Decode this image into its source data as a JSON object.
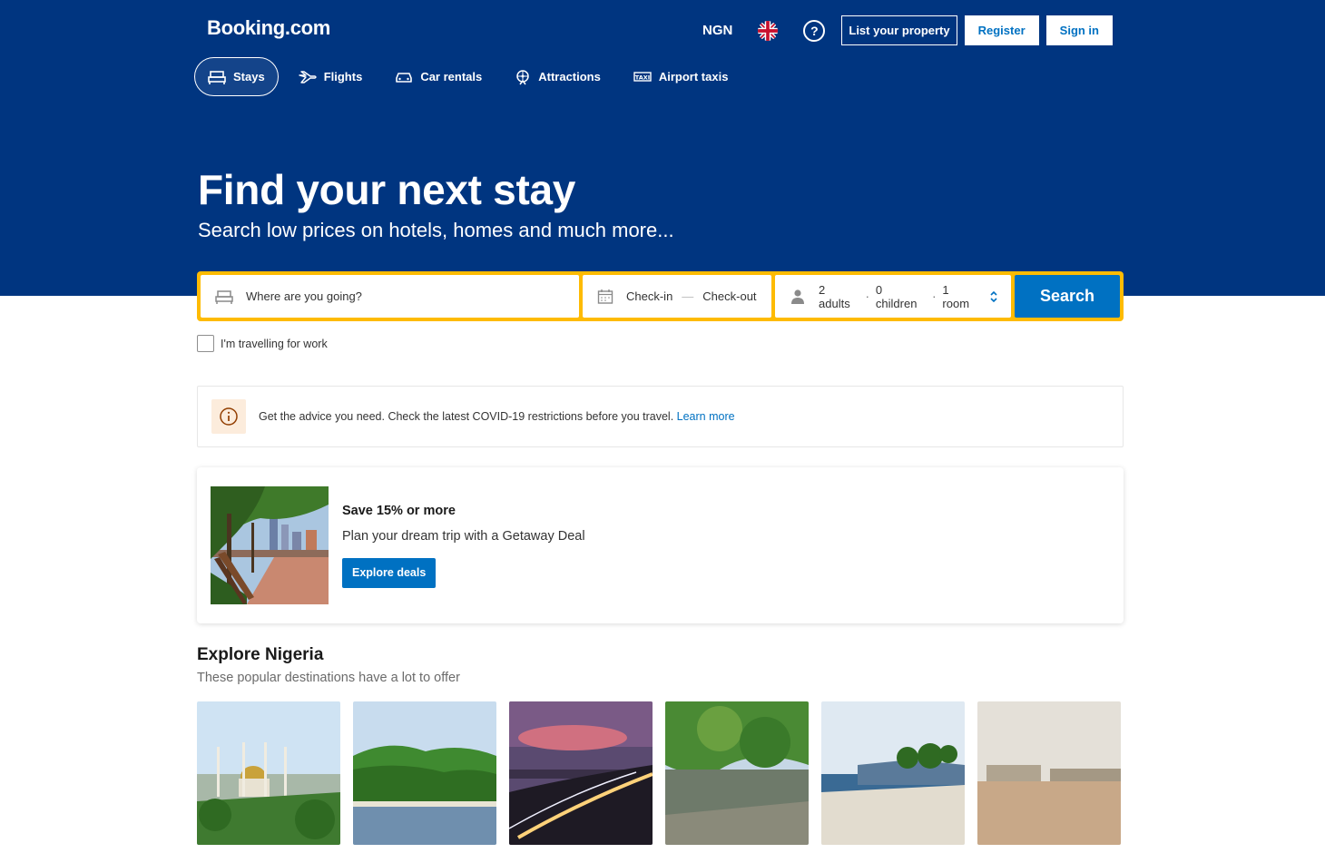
{
  "header": {
    "logo": "Booking.com",
    "currency": "NGN",
    "flag": "uk-flag-icon",
    "help": "?",
    "list_property": "List your property",
    "register": "Register",
    "sign_in": "Sign in"
  },
  "nav": [
    {
      "label": "Stays",
      "icon": "bed-icon",
      "active": true
    },
    {
      "label": "Flights",
      "icon": "plane-icon"
    },
    {
      "label": "Car rentals",
      "icon": "car-icon"
    },
    {
      "label": "Attractions",
      "icon": "attractions-icon"
    },
    {
      "label": "Airport taxis",
      "icon": "taxi-icon"
    }
  ],
  "hero": {
    "title": "Find your next stay",
    "subtitle": "Search low prices on hotels, homes and much more..."
  },
  "search": {
    "destination_placeholder": "Where are you going?",
    "check_in": "Check-in",
    "dash": "—",
    "check_out": "Check-out",
    "adults": "2 adults",
    "children": "0 children",
    "rooms": "1 room",
    "sep": "·",
    "button": "Search",
    "work_label": "I'm travelling for work"
  },
  "covid": {
    "text": "Get the advice you need. Check the latest COVID-19 restrictions before you travel.",
    "link": "Learn more"
  },
  "deal": {
    "title": "Save 15% or more",
    "text": "Plan your dream trip with a Getaway Deal",
    "button": "Explore deals"
  },
  "explore": {
    "title": "Explore Nigeria",
    "subtitle": "These popular destinations have a lot to offer"
  },
  "colors": {
    "brand_blue": "#003580",
    "action_blue": "#0071c2",
    "search_border": "#febb02"
  }
}
